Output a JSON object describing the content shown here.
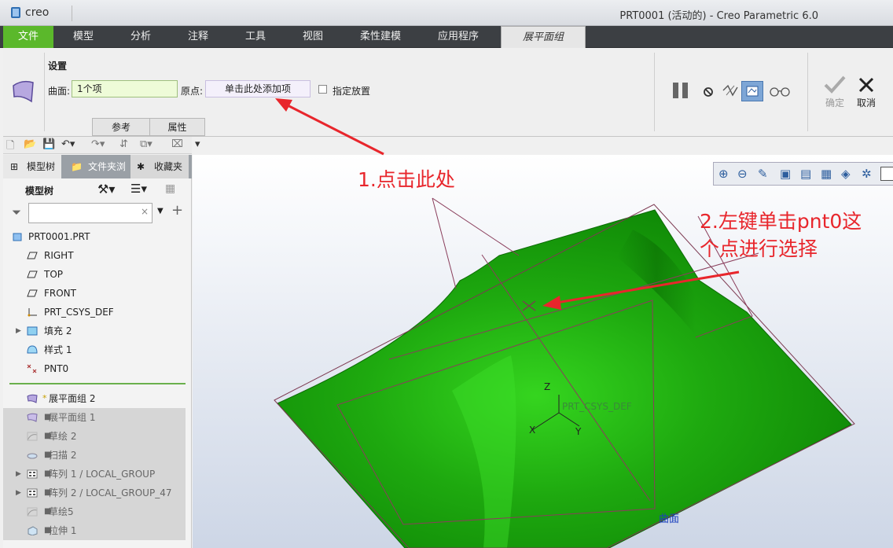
{
  "titlebar": {
    "app_logo": "creo",
    "window_title": "PRT0001 (活动的) - Creo Parametric 6.0"
  },
  "menu": {
    "items": [
      "文件",
      "模型",
      "分析",
      "注释",
      "工具",
      "视图",
      "柔性建模",
      "应用程序",
      "展平面组"
    ]
  },
  "dashboard": {
    "section_label": "设置",
    "surface_label": "曲面:",
    "surface_value": "1个项",
    "origin_label": "原点:",
    "origin_value": "单击此处添加项",
    "place_label": "指定放置",
    "tabs": [
      "参考",
      "属性"
    ],
    "ok_label": "确定",
    "cancel_label": "取消"
  },
  "panel": {
    "tabs": [
      "模型树",
      "文件夹浏",
      "收藏夹"
    ],
    "tree_header": "模型树",
    "filter_placeholder": ""
  },
  "tree": {
    "items": [
      {
        "label": "PRT0001.PRT",
        "icon": "part-icon"
      },
      {
        "label": "RIGHT",
        "icon": "datum-plane-icon"
      },
      {
        "label": "TOP",
        "icon": "datum-plane-icon"
      },
      {
        "label": "FRONT",
        "icon": "datum-plane-icon"
      },
      {
        "label": "PRT_CSYS_DEF",
        "icon": "csys-icon"
      },
      {
        "label": "填充 2",
        "icon": "fill-icon"
      },
      {
        "label": "样式 1",
        "icon": "style-icon"
      },
      {
        "label": "PNT0",
        "icon": "point-icon"
      },
      {
        "label": "展平面组 2",
        "icon": "flatten-quilt-icon"
      },
      {
        "label": "展平面组 1",
        "icon": "flatten-quilt-icon"
      },
      {
        "label": "草绘 2",
        "icon": "sketch-icon"
      },
      {
        "label": "扫描 2",
        "icon": "sweep-icon"
      },
      {
        "label": "阵列 1 / LOCAL_GROUP",
        "icon": "pattern-icon"
      },
      {
        "label": "阵列 2 / LOCAL_GROUP_47",
        "icon": "pattern-icon"
      },
      {
        "label": "草绘5",
        "icon": "sketch-icon"
      },
      {
        "label": "拉伸 1",
        "icon": "extrude-icon"
      }
    ]
  },
  "viewport": {
    "csys_label": "PRT_CSYS_DEF",
    "axis_x": "X",
    "axis_y": "Y",
    "axis_z": "Z",
    "surface_label": "曲面"
  },
  "annotations": {
    "step1": "1.点击此处",
    "step2_line1": "2.左键单击pnt0这",
    "step2_line2": "个点进行选择"
  },
  "colors": {
    "accent": "#5bb82b",
    "annotation": "#e8262c",
    "surface": "#1a9a0c"
  }
}
